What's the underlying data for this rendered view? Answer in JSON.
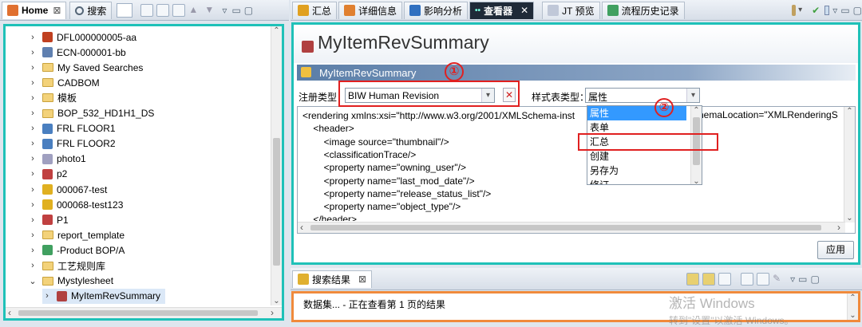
{
  "left_panel": {
    "tabs": [
      {
        "label": "Home",
        "close": "⊠"
      },
      {
        "label": "搜索"
      }
    ],
    "tree": [
      {
        "label": "DFL000000005-aa",
        "icon": "change-icon",
        "color": "#c04020"
      },
      {
        "label": "ECN-000001-bb",
        "icon": "document-icon",
        "color": "#6080b0"
      },
      {
        "label": "My Saved Searches",
        "icon": "folder-icon",
        "color": "#f3d27a"
      },
      {
        "label": "CADBOM",
        "icon": "folder-icon",
        "color": "#f3d27a"
      },
      {
        "label": "模板",
        "icon": "folder-icon",
        "color": "#f3d27a"
      },
      {
        "label": "BOP_532_HD1H1_DS",
        "icon": "folder-icon",
        "color": "#f3d27a"
      },
      {
        "label": "FRL FLOOR1",
        "icon": "assembly-icon",
        "color": "#4a7fc0"
      },
      {
        "label": "FRL FLOOR2",
        "icon": "assembly-icon",
        "color": "#4a7fc0"
      },
      {
        "label": "photo1",
        "icon": "image-icon",
        "color": "#a0a0c0"
      },
      {
        "label": "p2",
        "icon": "pencil-icon",
        "color": "#c04040"
      },
      {
        "label": "000067-test",
        "icon": "item-icon",
        "color": "#e0b020"
      },
      {
        "label": "000068-test123",
        "icon": "item-icon",
        "color": "#e0b020"
      },
      {
        "label": "P1",
        "icon": "pencil-icon",
        "color": "#c04040"
      },
      {
        "label": "report_template",
        "icon": "folder-icon",
        "color": "#f3d27a"
      },
      {
        "label": " -Product BOP/A",
        "icon": "bop-icon",
        "color": "#40a060"
      },
      {
        "label": "工艺规则库",
        "icon": "folder-icon",
        "color": "#f3d27a"
      },
      {
        "label": "Mystylesheet",
        "icon": "folder-icon",
        "color": "#f3d27a",
        "expanded": true
      },
      {
        "label": "MyItemRevSummary",
        "icon": "stylesheet-icon",
        "color": "#b04040",
        "selected": true
      }
    ]
  },
  "main": {
    "tabs": [
      {
        "label": "汇总"
      },
      {
        "label": "详细信息"
      },
      {
        "label": "影响分析"
      },
      {
        "label": "查看器",
        "active": true,
        "close": "✕"
      },
      {
        "label": "JT 预览"
      },
      {
        "label": "流程历史记录"
      }
    ],
    "title": "MyItemRevSummary",
    "section_title": "MyItemRevSummary",
    "reg_type_label": "注册类型：",
    "reg_type_value": "BIW Human Revision",
    "style_type_label": "样式表类型：",
    "style_type_value": "属性",
    "dropdown_options": [
      "属性",
      "表单",
      "汇总",
      "创建",
      "另存为",
      "修订"
    ],
    "xml_lines": [
      "<rendering xmlns:xsi=\"http://www.w3.org/2001/XMLSchema-inst",
      "    <header>",
      "        <image source=\"thumbnail\"/>",
      "        <classificationTrace/>",
      "        <property name=\"owning_user\"/>",
      "        <property name=\"last_mod_date\"/>",
      "        <property name=\"release_status_list\"/>",
      "        <property name=\"object_type\"/>",
      "    </header>"
    ],
    "xml_tail": "hemaLocation=\"XMLRenderingS",
    "apply_label": "应用",
    "annotation_1": "①",
    "annotation_2": "②"
  },
  "search_results": {
    "tab_label": "搜索结果",
    "close": "⊠",
    "status": "数据集... - 正在查看第 1 页的结果"
  },
  "watermark": {
    "line1": "激活 Windows",
    "line2": "转到\"设置\"以激活 Windows。"
  },
  "colors": {
    "highlight_teal": "#1fc1b8",
    "highlight_orange": "#f08a3c",
    "annotation_red": "#e02020",
    "section_bar": "#5b7ea8",
    "selection_blue": "#3399ff"
  }
}
